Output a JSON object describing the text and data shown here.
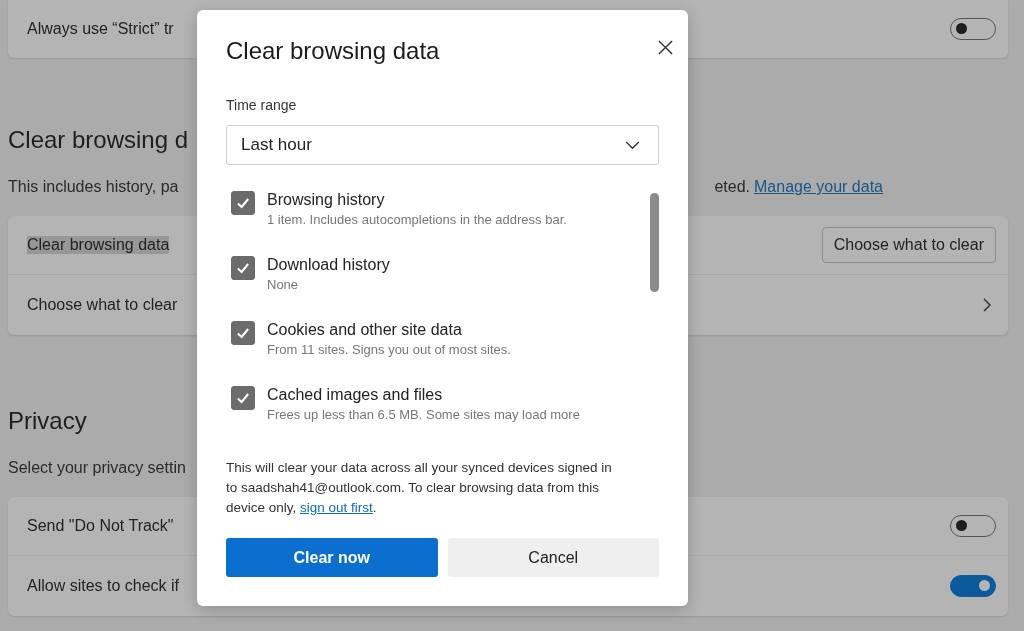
{
  "settings": {
    "strict_row": {
      "label": "Always use “Strict” tr",
      "on": false
    },
    "clear_section": {
      "heading": "Clear browsing d",
      "description_start": "This includes history, pa",
      "description_end": "eted.",
      "link": "Manage your data",
      "rows": [
        {
          "kind": "button",
          "label": "Clear browsing data",
          "highlighted": true,
          "button": "Choose what to clear"
        },
        {
          "kind": "chevron",
          "label": "Choose what to clear",
          "highlighted": false
        }
      ]
    },
    "privacy_section": {
      "heading": "Privacy",
      "description": "Select your privacy settin",
      "rows": [
        {
          "label": "Send \"Do Not Track\"",
          "on": false
        },
        {
          "label": "Allow sites to check if",
          "on": true
        }
      ]
    }
  },
  "dialog": {
    "title": "Clear browsing data",
    "time_range_label": "Time range",
    "time_range": "Last hour",
    "items": [
      {
        "label": "Browsing history",
        "detail": "1 item. Includes autocompletions in the address bar.",
        "checked": true
      },
      {
        "label": "Download history",
        "detail": "None",
        "checked": true
      },
      {
        "label": "Cookies and other site data",
        "detail": "From 11 sites. Signs you out of most sites.",
        "checked": true
      },
      {
        "label": "Cached images and files",
        "detail": "Frees up less than 6.5 MB. Some sites may load more",
        "checked": true
      }
    ],
    "notice": "This will clear your data across all your synced devices signed in to saadshah41@outlook.com. To clear browsing data from this device only, ",
    "notice_link": "sign out first",
    "notice_end": ".",
    "buttons": [
      {
        "label": "Clear now",
        "kind": "primary"
      },
      {
        "label": "Cancel",
        "kind": "secondary"
      }
    ]
  }
}
